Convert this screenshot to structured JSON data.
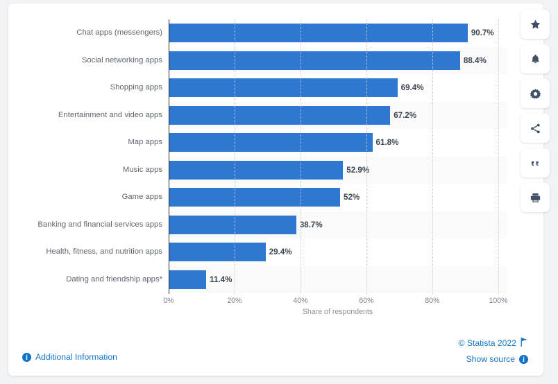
{
  "chart_data": {
    "type": "bar",
    "orientation": "horizontal",
    "title": "",
    "xlabel": "Share of respondents",
    "ylabel": "",
    "xlim": [
      0,
      100
    ],
    "xticks": [
      "0%",
      "20%",
      "40%",
      "60%",
      "80%",
      "100%"
    ],
    "xtick_values": [
      0,
      20,
      40,
      60,
      80,
      100
    ],
    "grid": "vertical-dotted",
    "legend": "none",
    "bar_color": "#2e78d2",
    "categories": [
      "Chat apps (messengers)",
      "Social networking apps",
      "Shopping apps",
      "Entertainment and video apps",
      "Map apps",
      "Music apps",
      "Game apps",
      "Banking and financial services apps",
      "Health, fitness, and nutrition apps",
      "Dating and friendship apps*"
    ],
    "values": [
      90.7,
      88.4,
      69.4,
      67.2,
      61.8,
      52.9,
      52,
      38.7,
      29.4,
      11.4
    ],
    "value_labels": [
      "90.7%",
      "88.4%",
      "69.4%",
      "67.2%",
      "61.8%",
      "52.9%",
      "52%",
      "38.7%",
      "29.4%",
      "11.4%"
    ]
  },
  "footer": {
    "additional_information": "Additional Information",
    "copyright": "© Statista 2022",
    "show_source": "Show source"
  },
  "rail": {
    "buttons": [
      {
        "name": "favorite",
        "label": "star-icon"
      },
      {
        "name": "notify",
        "label": "bell-icon"
      },
      {
        "name": "settings",
        "label": "gear-icon"
      },
      {
        "name": "share",
        "label": "share-icon"
      },
      {
        "name": "cite",
        "label": "quote-icon"
      },
      {
        "name": "print",
        "label": "print-icon"
      }
    ]
  },
  "colors": {
    "bar": "#2e78d2",
    "link": "#1273c6",
    "page_bg": "#f2f3f5",
    "card_bg": "#ffffff",
    "stripe": "#fafafa",
    "label_text": "#5d6670",
    "value_text": "#3d4650"
  }
}
